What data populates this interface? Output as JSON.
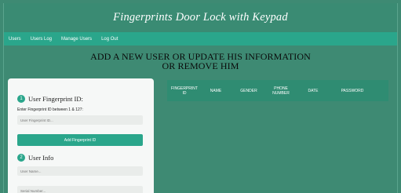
{
  "app": {
    "title": "Fingerprints Door Lock with Keypad"
  },
  "nav": {
    "items": [
      "Users",
      "Users Log",
      "Manage Users",
      "Log Out"
    ]
  },
  "heading": {
    "line1": "ADD A NEW USER OR UPDATE HIS INFORMATION",
    "line2": "OR REMOVE HIM"
  },
  "form": {
    "section1": {
      "number": "1",
      "title": "User Fingerprint ID:"
    },
    "id_label": "Enter Fingerprint ID between 1 & 127:",
    "id_placeholder": "User Fingerprint ID...",
    "add_button": "Add Fingerprint ID",
    "section2": {
      "number": "2",
      "title": "User Info"
    },
    "name_placeholder": "User Name...",
    "serial_placeholder": "Serial Number..."
  },
  "table": {
    "headers": [
      "FINGERPRINT ID",
      "NAME",
      "GENDER",
      "PHONE NUMBER",
      "DATE",
      "PASSWORD"
    ]
  },
  "colors": {
    "background": "#3e8a73",
    "nav": "#2aa68b",
    "accent": "#2aa68b",
    "panel": "#f6f8f7"
  }
}
